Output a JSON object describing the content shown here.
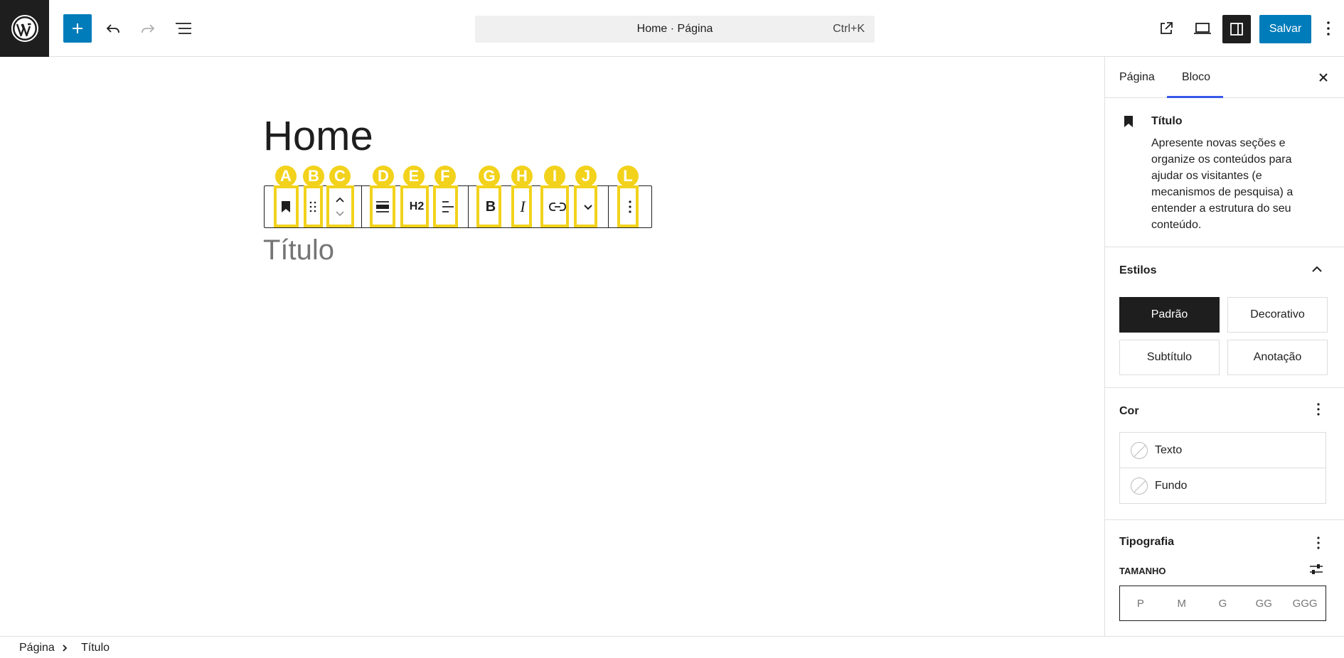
{
  "header": {
    "command_title": "Home · Página",
    "command_shortcut": "Ctrl+K",
    "save_label": "Salvar",
    "accent": "#007cba"
  },
  "editor": {
    "page_title": "Home",
    "heading_placeholder": "Título",
    "toolbar": {
      "h2_label": "H2",
      "bold_label": "B",
      "italic_label": "I"
    },
    "marks": [
      "A",
      "B",
      "C",
      "D",
      "E",
      "F",
      "G",
      "H",
      "I",
      "J",
      "L"
    ]
  },
  "sidebar": {
    "tabs": [
      {
        "label": "Página",
        "active": false
      },
      {
        "label": "Bloco",
        "active": true
      }
    ],
    "block": {
      "title": "Título",
      "description": "Apresente novas seções e organize os conteúdos para ajudar os visitantes (e mecanismos de pesquisa) a entender a estrutura do seu conteúdo."
    },
    "styles": {
      "title": "Estilos",
      "options": [
        "Padrão",
        "Decorativo",
        "Subtítulo",
        "Anotação"
      ]
    },
    "color": {
      "title": "Cor",
      "items": [
        "Texto",
        "Fundo"
      ]
    },
    "typography": {
      "title": "Tipografia",
      "size_label": "TAMANHO",
      "sizes": [
        "P",
        "M",
        "G",
        "GG",
        "GGG"
      ]
    }
  },
  "footer": {
    "breadcrumbs": [
      "Página",
      "Título"
    ]
  }
}
